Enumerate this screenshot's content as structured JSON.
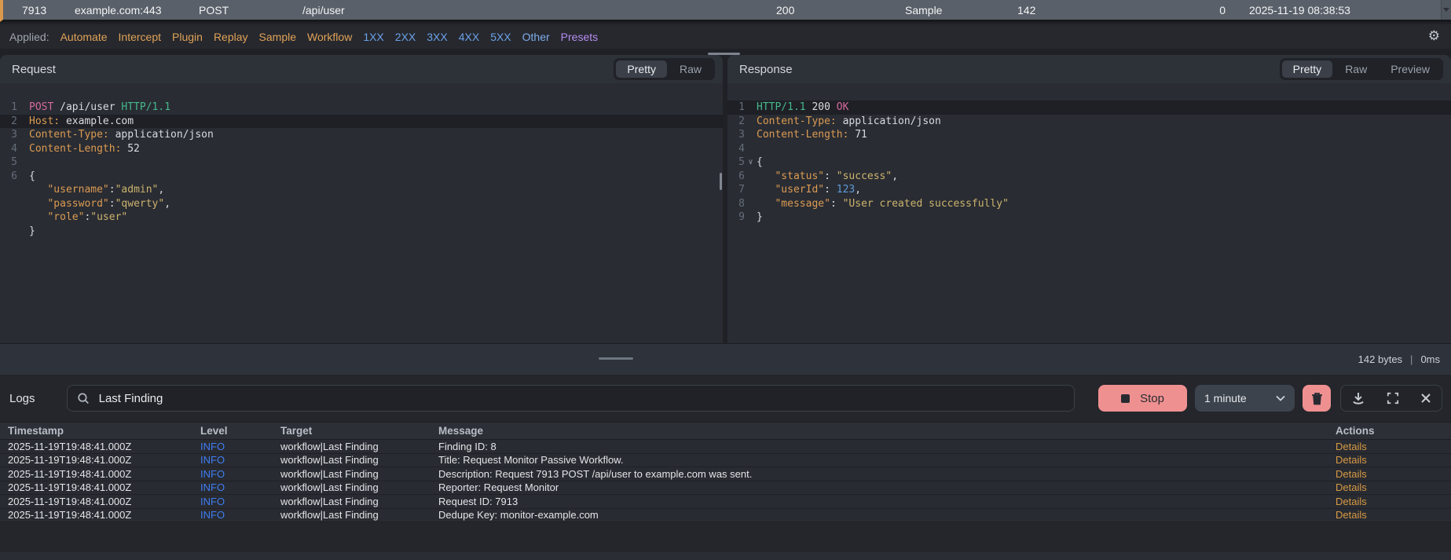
{
  "colors": {
    "accent_orange": "#d9984b",
    "salmon": "#ef9090",
    "info_blue": "#3f7df2",
    "details_orange": "#d89a45",
    "selected_row": "#5a6069"
  },
  "request_row": {
    "id": "7913",
    "host": "example.com:443",
    "method": "POST",
    "path": "/api/user",
    "status": "200",
    "source": "Sample",
    "length": "142",
    "extra": "0",
    "time": "2025-11-19 08:38:53"
  },
  "filter_bar": {
    "label": "Applied:",
    "filters": [
      {
        "label": "Automate",
        "color": "#e0a257"
      },
      {
        "label": "Intercept",
        "color": "#e0a257"
      },
      {
        "label": "Plugin",
        "color": "#e0a257"
      },
      {
        "label": "Replay",
        "color": "#e0a257"
      },
      {
        "label": "Sample",
        "color": "#e0a257"
      },
      {
        "label": "Workflow",
        "color": "#e0a257"
      },
      {
        "label": "1XX",
        "color": "#6aa2e8"
      },
      {
        "label": "2XX",
        "color": "#6aa2e8"
      },
      {
        "label": "3XX",
        "color": "#6aa2e8"
      },
      {
        "label": "4XX",
        "color": "#6aa2e8"
      },
      {
        "label": "5XX",
        "color": "#6aa2e8"
      },
      {
        "label": "Other",
        "color": "#7fadea"
      },
      {
        "label": "Presets",
        "color": "#b78df0"
      }
    ]
  },
  "request_panel": {
    "title": "Request",
    "tabs": [
      {
        "label": "Pretty",
        "active": true
      },
      {
        "label": "Raw",
        "active": false
      }
    ],
    "lines": [
      {
        "num": "1",
        "tokens": [
          [
            "method",
            "POST"
          ],
          [
            "plain",
            " /api/user "
          ],
          [
            "proto",
            "HTTP/1.1"
          ]
        ]
      },
      {
        "num": "2",
        "highlight": true,
        "tokens": [
          [
            "hname",
            "Host:"
          ],
          [
            "plain",
            " example.com"
          ]
        ]
      },
      {
        "num": "3",
        "tokens": [
          [
            "hname",
            "Content-Type:"
          ],
          [
            "plain",
            " application/json"
          ]
        ]
      },
      {
        "num": "4",
        "tokens": [
          [
            "hname",
            "Content-Length:"
          ],
          [
            "plain",
            " 52"
          ]
        ]
      },
      {
        "num": "5",
        "tokens": []
      },
      {
        "num": "6",
        "tokens": [
          [
            "plain",
            "{"
          ]
        ]
      },
      {
        "num": "",
        "tokens": [
          [
            "plain",
            "   "
          ],
          [
            "key",
            "\"username\""
          ],
          [
            "plain",
            ":"
          ],
          [
            "str",
            "\"admin\""
          ],
          [
            "plain",
            ","
          ]
        ]
      },
      {
        "num": "",
        "tokens": [
          [
            "plain",
            "   "
          ],
          [
            "key",
            "\"password\""
          ],
          [
            "plain",
            ":"
          ],
          [
            "str",
            "\"qwerty\""
          ],
          [
            "plain",
            ","
          ]
        ]
      },
      {
        "num": "",
        "tokens": [
          [
            "plain",
            "   "
          ],
          [
            "key",
            "\"role\""
          ],
          [
            "plain",
            ":"
          ],
          [
            "str",
            "\"user\""
          ]
        ]
      },
      {
        "num": "",
        "tokens": [
          [
            "plain",
            "}"
          ]
        ]
      }
    ]
  },
  "response_panel": {
    "title": "Response",
    "tabs": [
      {
        "label": "Pretty",
        "active": true
      },
      {
        "label": "Raw",
        "active": false
      },
      {
        "label": "Preview",
        "active": false
      }
    ],
    "lines": [
      {
        "num": "1",
        "highlight": true,
        "tokens": [
          [
            "proto",
            "HTTP/1.1"
          ],
          [
            "plain",
            " 200 "
          ],
          [
            "method",
            "OK"
          ]
        ]
      },
      {
        "num": "2",
        "tokens": [
          [
            "hname",
            "Content-Type:"
          ],
          [
            "plain",
            " application/json"
          ]
        ]
      },
      {
        "num": "3",
        "tokens": [
          [
            "hname",
            "Content-Length:"
          ],
          [
            "plain",
            " 71"
          ]
        ]
      },
      {
        "num": "4",
        "tokens": []
      },
      {
        "num": "5",
        "fold": true,
        "tokens": [
          [
            "plain",
            "{"
          ]
        ]
      },
      {
        "num": "6",
        "tokens": [
          [
            "plain",
            "   "
          ],
          [
            "key",
            "\"status\""
          ],
          [
            "plain",
            ": "
          ],
          [
            "str",
            "\"success\""
          ],
          [
            "plain",
            ","
          ]
        ]
      },
      {
        "num": "7",
        "tokens": [
          [
            "plain",
            "   "
          ],
          [
            "key",
            "\"userId\""
          ],
          [
            "plain",
            ": "
          ],
          [
            "num",
            "123"
          ],
          [
            "plain",
            ","
          ]
        ]
      },
      {
        "num": "8",
        "tokens": [
          [
            "plain",
            "   "
          ],
          [
            "key",
            "\"message\""
          ],
          [
            "plain",
            ": "
          ],
          [
            "str",
            "\"User created successfully\""
          ]
        ]
      },
      {
        "num": "9",
        "tokens": [
          [
            "plain",
            "}"
          ]
        ]
      }
    ],
    "footer": {
      "size": "142 bytes",
      "separator": "|",
      "time": "0ms"
    }
  },
  "logs_panel": {
    "title": "Logs",
    "search": {
      "value": "Last Finding"
    },
    "stop_label": "Stop",
    "interval_value": "1 minute",
    "table": {
      "columns": [
        "Timestamp",
        "Level",
        "Target",
        "Message",
        "Actions"
      ],
      "rows": [
        {
          "timestamp": "2025-11-19T19:48:41.000Z",
          "level": "INFO",
          "target": "workflow|Last Finding",
          "message": "Finding ID: 8",
          "action": "Details"
        },
        {
          "timestamp": "2025-11-19T19:48:41.000Z",
          "level": "INFO",
          "target": "workflow|Last Finding",
          "message": "Title: Request Monitor Passive Workflow.",
          "action": "Details"
        },
        {
          "timestamp": "2025-11-19T19:48:41.000Z",
          "level": "INFO",
          "target": "workflow|Last Finding",
          "message": "Description: Request 7913 POST /api/user to example.com was sent.",
          "action": "Details"
        },
        {
          "timestamp": "2025-11-19T19:48:41.000Z",
          "level": "INFO",
          "target": "workflow|Last Finding",
          "message": "Reporter: Request Monitor",
          "action": "Details"
        },
        {
          "timestamp": "2025-11-19T19:48:41.000Z",
          "level": "INFO",
          "target": "workflow|Last Finding",
          "message": "Request ID: 7913",
          "action": "Details"
        },
        {
          "timestamp": "2025-11-19T19:48:41.000Z",
          "level": "INFO",
          "target": "workflow|Last Finding",
          "message": "Dedupe Key: monitor-example.com",
          "action": "Details"
        }
      ]
    }
  }
}
